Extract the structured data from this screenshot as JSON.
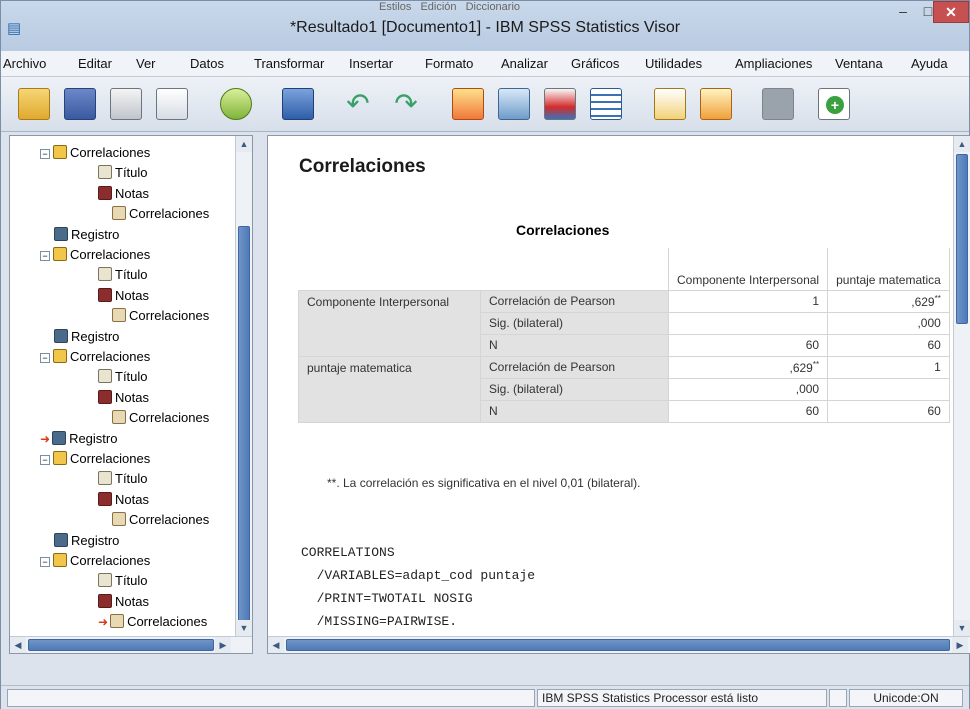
{
  "window": {
    "title": "*Resultado1 [Documento1] - IBM SPSS Statistics Visor",
    "ghost_tabs": [
      "Estilos",
      "Edición",
      "Diccionario"
    ],
    "controls": {
      "minimize": "–",
      "maximize": "□",
      "close": "✕"
    }
  },
  "menu": [
    "Archivo",
    "Editar",
    "Ver",
    "Datos",
    "Transformar",
    "Insertar",
    "Formato",
    "Analizar",
    "Gráficos",
    "Utilidades",
    "Ampliaciones",
    "Ventana",
    "Ayuda"
  ],
  "toolbar": {
    "icons": [
      "open-folder-icon",
      "save-icon",
      "print-icon",
      "print-preview-icon",
      "export-icon",
      "recall-dialog-icon",
      "undo-icon",
      "redo-icon",
      "goto-data-icon",
      "goto-case-icon",
      "insert-variable-icon",
      "variables-icon",
      "designate-window-icon",
      "select-last-output-icon",
      "disabled-icon",
      "add-icon"
    ]
  },
  "outline": {
    "items": [
      {
        "label": "Correlaciones",
        "type": "book",
        "level": 1,
        "expander": "−"
      },
      {
        "label": "Título",
        "type": "title",
        "level": 2
      },
      {
        "label": "Notas",
        "type": "notes",
        "level": 2
      },
      {
        "label": "Correlaciones",
        "type": "table",
        "level": 3
      },
      {
        "label": "Registro",
        "type": "log",
        "level": 1
      },
      {
        "label": "Correlaciones",
        "type": "book",
        "level": 1,
        "expander": "−"
      },
      {
        "label": "Título",
        "type": "title",
        "level": 2
      },
      {
        "label": "Notas",
        "type": "notes",
        "level": 2
      },
      {
        "label": "Correlaciones",
        "type": "table",
        "level": 3
      },
      {
        "label": "Registro",
        "type": "log",
        "level": 1
      },
      {
        "label": "Correlaciones",
        "type": "book",
        "level": 1,
        "expander": "−"
      },
      {
        "label": "Título",
        "type": "title",
        "level": 2
      },
      {
        "label": "Notas",
        "type": "notes",
        "level": 2
      },
      {
        "label": "Correlaciones",
        "type": "table",
        "level": 3
      },
      {
        "label": "Registro",
        "type": "log",
        "level": 1,
        "current": true
      },
      {
        "label": "Correlaciones",
        "type": "book",
        "level": 1,
        "expander": "−"
      },
      {
        "label": "Título",
        "type": "title",
        "level": 2
      },
      {
        "label": "Notas",
        "type": "notes",
        "level": 2
      },
      {
        "label": "Correlaciones",
        "type": "table",
        "level": 3
      },
      {
        "label": "Registro",
        "type": "log",
        "level": 1
      },
      {
        "label": "Correlaciones",
        "type": "book",
        "level": 1,
        "expander": "−"
      },
      {
        "label": "Título",
        "type": "title",
        "level": 2
      },
      {
        "label": "Notas",
        "type": "notes",
        "level": 2
      },
      {
        "label": "Correlaciones",
        "type": "table",
        "level": 3,
        "current": true
      }
    ]
  },
  "content": {
    "heading": "Correlaciones",
    "table_title": "Correlaciones",
    "columns": [
      "Componente Interpersonal",
      "puntaje matematica"
    ],
    "rows": [
      {
        "var": "Componente Interpersonal",
        "stat": "Correlación de Pearson",
        "v1": "1",
        "v2": ",629",
        "v2_sup": "**"
      },
      {
        "var": "",
        "stat": "Sig. (bilateral)",
        "v1": "",
        "v2": ",000"
      },
      {
        "var": "",
        "stat": "N",
        "v1": "60",
        "v2": "60"
      },
      {
        "var": "puntaje matematica",
        "stat": "Correlación de Pearson",
        "v1": ",629",
        "v1_sup": "**",
        "v2": "1"
      },
      {
        "var": "",
        "stat": "Sig. (bilateral)",
        "v1": ",000",
        "v2": ""
      },
      {
        "var": "",
        "stat": "N",
        "v1": "60",
        "v2": "60"
      }
    ],
    "footnote": "**. La correlación es significativa en el nivel 0,01 (bilateral).",
    "syntax": [
      "CORRELATIONS",
      "  /VARIABLES=adapt_cod puntaje",
      "  /PRINT=TWOTAIL NOSIG",
      "  /MISSING=PAIRWISE."
    ]
  },
  "status": {
    "processor": "IBM SPSS Statistics Processor está listo",
    "unicode": "Unicode:ON"
  }
}
